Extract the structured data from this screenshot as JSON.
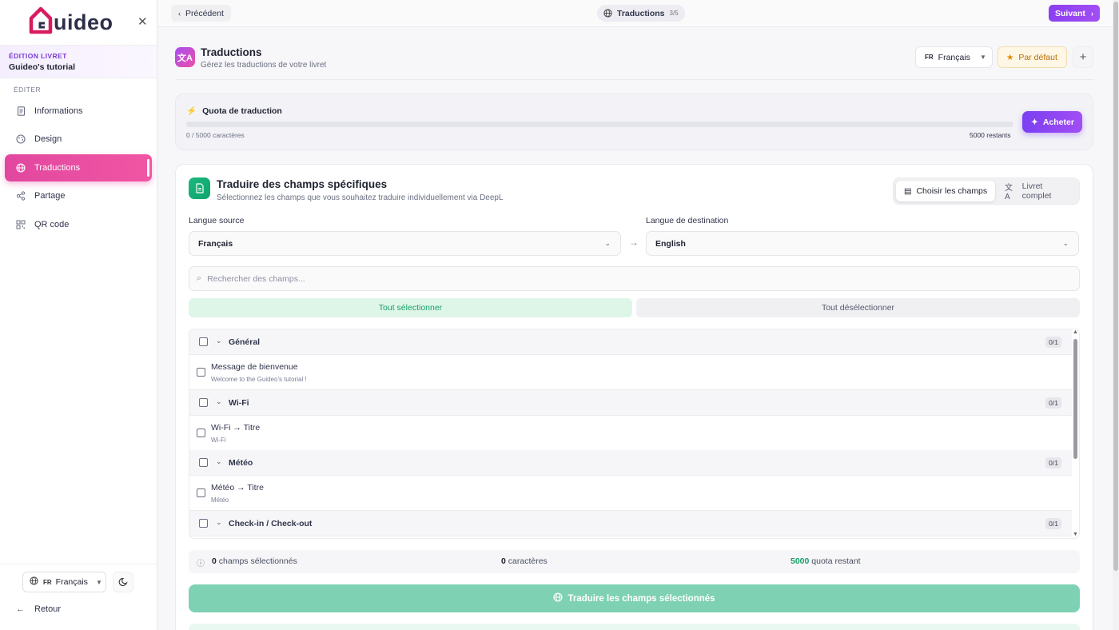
{
  "brand": {
    "logo_text": "uideo"
  },
  "sidebar": {
    "edition_label": "ÉDITION LIVRET",
    "edition_name": "Guideo's tutorial",
    "section_label": "ÉDITER",
    "items": [
      {
        "label": "Informations",
        "icon": "document-icon"
      },
      {
        "label": "Design",
        "icon": "palette-icon"
      },
      {
        "label": "Traductions",
        "icon": "globe-icon",
        "active": true
      },
      {
        "label": "Partage",
        "icon": "share-icon"
      },
      {
        "label": "QR code",
        "icon": "qrcode-icon"
      }
    ],
    "lang_code": "FR",
    "lang_label": "Français",
    "back_label": "Retour"
  },
  "topbar": {
    "prev_label": "Précédent",
    "step_label": "Traductions",
    "step_counter": "3/5",
    "next_label": "Suivant"
  },
  "header": {
    "title": "Traductions",
    "subtitle": "Gérez les traductions de votre livret",
    "lang_code": "FR",
    "lang_label": "Français",
    "default_label": "Par défaut"
  },
  "quota": {
    "title": "Quota de traduction",
    "used_text": "0 / 5000 caractères",
    "remaining_text": "5000 restants",
    "progress": 0,
    "buy_label": "Acheter"
  },
  "translate_card": {
    "title": "Traduire des champs spécifiques",
    "subtitle": "Sélectionnez les champs que vous souhaitez traduire individuellement via DeepL",
    "mode_fields": "Choisir les champs",
    "mode_full": "Livret complet",
    "source_label": "Langue source",
    "source_value": "Français",
    "target_label": "Langue de destination",
    "target_value": "English",
    "search_placeholder": "Rechercher des champs...",
    "select_all": "Tout sélectionner",
    "deselect_all": "Tout désélectionner",
    "groups": [
      {
        "name": "Général",
        "count": "0/1",
        "field": "Message de bienvenue",
        "value": "Welcome to the Guideo's tutorial !"
      },
      {
        "name": "Wi-Fi",
        "count": "0/1",
        "field": "Wi-Fi → Titre",
        "value": "Wi-Fi"
      },
      {
        "name": "Météo",
        "count": "0/1",
        "field": "Météo → Titre",
        "value": "Météo"
      },
      {
        "name": "Check-in / Check-out",
        "count": "0/1"
      }
    ],
    "stats": {
      "selected_num": "0",
      "selected_text": "champs sélectionnés",
      "chars_num": "0",
      "chars_text": "caractères",
      "quota_num": "5000",
      "quota_text": "quota restant"
    },
    "translate_btn": "Traduire les champs sélectionnés"
  },
  "colors": {
    "accent": "#8b3ff0",
    "pink": "#e1479f",
    "green": "#17a067"
  }
}
